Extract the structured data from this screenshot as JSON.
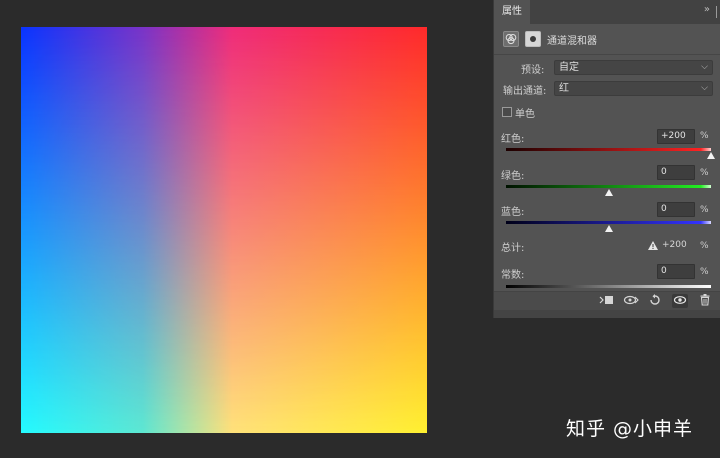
{
  "properties_panel": {
    "tab_label": "属性",
    "collapse_glyph": "»",
    "adjustment_title": "通道混和器",
    "preset": {
      "label": "预设:",
      "value": "自定"
    },
    "output_channel": {
      "label": "输出通道:",
      "value": "红"
    },
    "monochrome": {
      "label": "单色",
      "checked": false
    },
    "sliders": [
      {
        "label": "红色:",
        "value": "+200",
        "percent": "%",
        "position": 1.0
      },
      {
        "label": "绿色:",
        "value": "0",
        "percent": "%",
        "position": 0.5
      },
      {
        "label": "蓝色:",
        "value": "0",
        "percent": "%",
        "position": 0.5
      }
    ],
    "total": {
      "label": "总计:",
      "value": "+200",
      "percent": "%"
    },
    "constant": {
      "label": "常数:",
      "value": "0",
      "percent": "%",
      "position": 0.5
    }
  },
  "watermark": "知乎 @小申羊",
  "colors": {
    "panel_bg": "#535353",
    "app_bg": "#2b2b2b",
    "red_track_start": "#1b0000",
    "red_track_end": "#ff2222",
    "green_track_end": "#22ee22",
    "blue_track_end": "#3333ff"
  },
  "icons": [
    "channel-mixer-icon",
    "layer-mask-icon",
    "clip-to-layer-icon",
    "view-previous-icon",
    "reset-icon",
    "visibility-icon",
    "delete-icon",
    "warning-icon",
    "chevron-down-icon",
    "collapse-icon"
  ]
}
